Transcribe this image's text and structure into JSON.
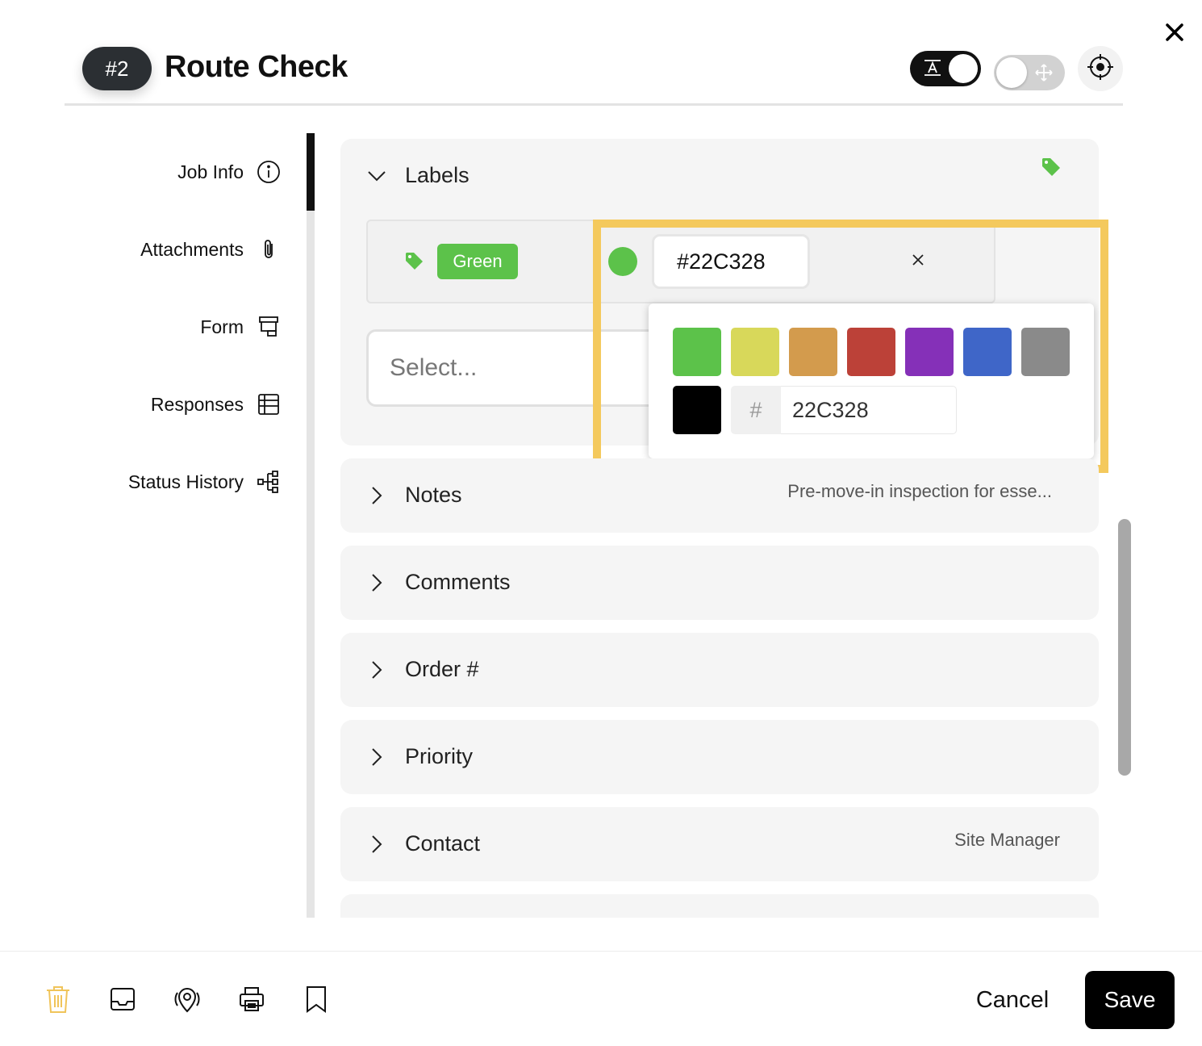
{
  "header": {
    "badge": "#2",
    "title": "Route Check",
    "toggle_text_icon": "text-format-icon",
    "toggle_move_icon": "move-icon",
    "target_icon": "crosshair-icon",
    "close_icon": "close-icon"
  },
  "sidebar": {
    "items": [
      {
        "label": "Job Info",
        "icon": "info-icon"
      },
      {
        "label": "Attachments",
        "icon": "paperclip-icon"
      },
      {
        "label": "Form",
        "icon": "form-icon"
      },
      {
        "label": "Responses",
        "icon": "table-icon"
      },
      {
        "label": "Status History",
        "icon": "hierarchy-icon"
      }
    ]
  },
  "labels_section": {
    "title": "Labels",
    "label_chip": "Green",
    "hex_value": "#22C328",
    "select_placeholder": "Select..."
  },
  "color_picker": {
    "swatches": [
      "#5cc24a",
      "#d8d85a",
      "#d39b4d",
      "#bc4138",
      "#8530b8",
      "#3f66c8",
      "#8a8a8a",
      "#000000"
    ],
    "hash": "#",
    "hex_field": "22C328"
  },
  "sections": [
    {
      "title": "Notes",
      "value": "Pre-move-in inspection for esse..."
    },
    {
      "title": "Comments",
      "value": ""
    },
    {
      "title": "Order #",
      "value": ""
    },
    {
      "title": "Priority",
      "value": ""
    },
    {
      "title": "Contact",
      "value": "Site Manager"
    }
  ],
  "footer": {
    "icons": [
      "trash-icon",
      "inbox-icon",
      "map-pin-icon",
      "print-icon",
      "bookmark-icon"
    ],
    "cancel": "Cancel",
    "save": "Save"
  },
  "colors": {
    "accent_green": "#5cc24a",
    "highlight": "#f4c95d",
    "trash_icon": "#f0c45a"
  }
}
